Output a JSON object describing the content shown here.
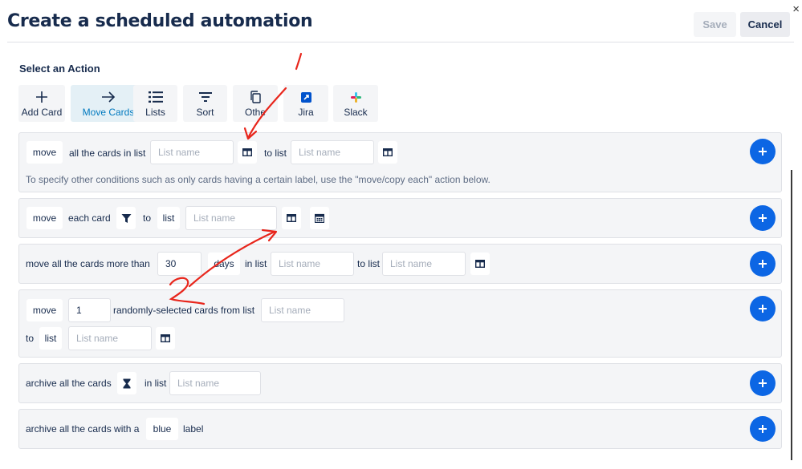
{
  "dialog": {
    "title": "Create a scheduled automation",
    "close_glyph": "×",
    "save_label": "Save",
    "cancel_label": "Cancel"
  },
  "section_label": "Select an Action",
  "tabs": [
    {
      "label": "Add Card",
      "icon": "plus-icon",
      "active": false
    },
    {
      "label": "Move Cards",
      "icon": "arrow-right-icon",
      "active": true
    },
    {
      "label": "Lists",
      "icon": "list-icon",
      "active": false
    },
    {
      "label": "Sort",
      "icon": "sort-icon",
      "active": false
    },
    {
      "label": "Othe",
      "icon": "copy-icon",
      "active": false
    },
    {
      "label": "Jira",
      "icon": "jira-icon",
      "active": false
    },
    {
      "label": "Slack",
      "icon": "slack-icon",
      "active": false
    }
  ],
  "rows": {
    "r1": {
      "move": "move",
      "text1": "all the cards in list",
      "list1_placeholder": "List name",
      "text2": "to list",
      "list2_placeholder": "List name",
      "hint": "To specify other conditions such as only cards having a certain label, use the \"move/copy each\" action below."
    },
    "r2": {
      "move": "move",
      "text1": "each card",
      "text2": "to",
      "list_chip": "list",
      "list_placeholder": "List name"
    },
    "r3": {
      "text1": "move all the cards more than",
      "days_value": "30",
      "days_chip": "days",
      "text2": "in list",
      "list1_placeholder": "List name",
      "text3": "to list",
      "list2_placeholder": "List name"
    },
    "r4": {
      "move": "move",
      "count_value": "1",
      "text1": "randomly-selected cards from list",
      "list1_placeholder": "List name",
      "to": "to",
      "list_chip": "list",
      "list2_placeholder": "List name"
    },
    "r5": {
      "text1": "archive all the cards",
      "text2": "in list",
      "list_placeholder": "List name"
    },
    "r6": {
      "text1": "archive all the cards with a",
      "label_chip": "blue",
      "text2": "label"
    }
  },
  "annotations": {
    "label_1": "1",
    "label_2": "2",
    "color": "#e8261c"
  },
  "colors": {
    "accent_blue": "#0c66e4",
    "active_tab_text": "#0079bf",
    "active_tab_bg": "#e4f0f6"
  }
}
